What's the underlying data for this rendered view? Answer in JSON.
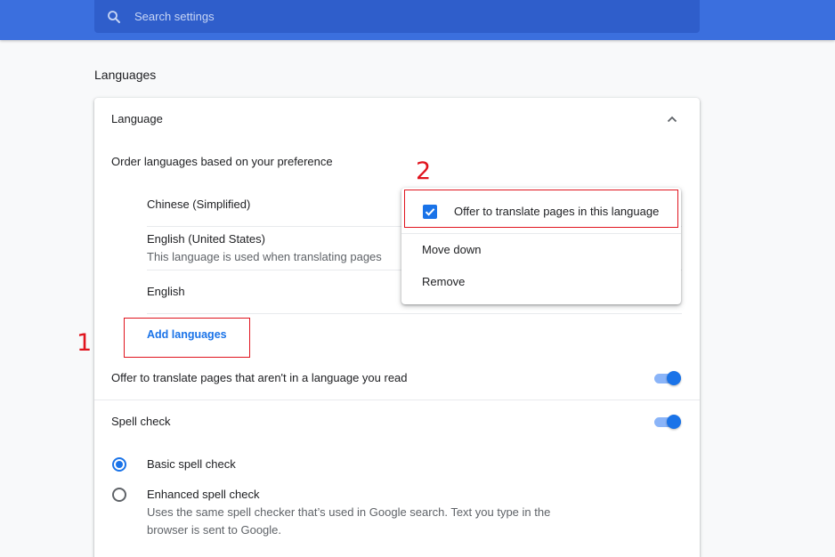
{
  "search": {
    "placeholder": "Search settings"
  },
  "page": {
    "section_title": "Languages"
  },
  "language_card": {
    "header": "Language",
    "order_label": "Order languages based on your preference",
    "languages": [
      {
        "name": "Chinese (Simplified)",
        "note": ""
      },
      {
        "name": "English (United States)",
        "note": "This language is used when translating pages"
      },
      {
        "name": "English",
        "note": ""
      }
    ],
    "add_languages": "Add languages",
    "offer_translate_label": "Offer to translate pages that aren't in a language you read",
    "offer_translate_enabled": true
  },
  "context_menu": {
    "offer_translate_item": "Offer to translate pages in this language",
    "offer_translate_checked": true,
    "move_down": "Move down",
    "remove": "Remove"
  },
  "spell_check": {
    "label": "Spell check",
    "enabled": true,
    "options": [
      {
        "label": "Basic spell check",
        "description": "",
        "selected": true
      },
      {
        "label": "Enhanced spell check",
        "description_line1": "Uses the same spell checker that’s used in Google search. Text you type in the",
        "description_line2": "browser is sent to Google.",
        "selected": false
      }
    ]
  },
  "annotations": {
    "marker_1": "1",
    "marker_2": "2"
  },
  "colors": {
    "accent": "#1a73e8",
    "header_bg": "#3b6fde",
    "annotation": "#e0141e"
  }
}
